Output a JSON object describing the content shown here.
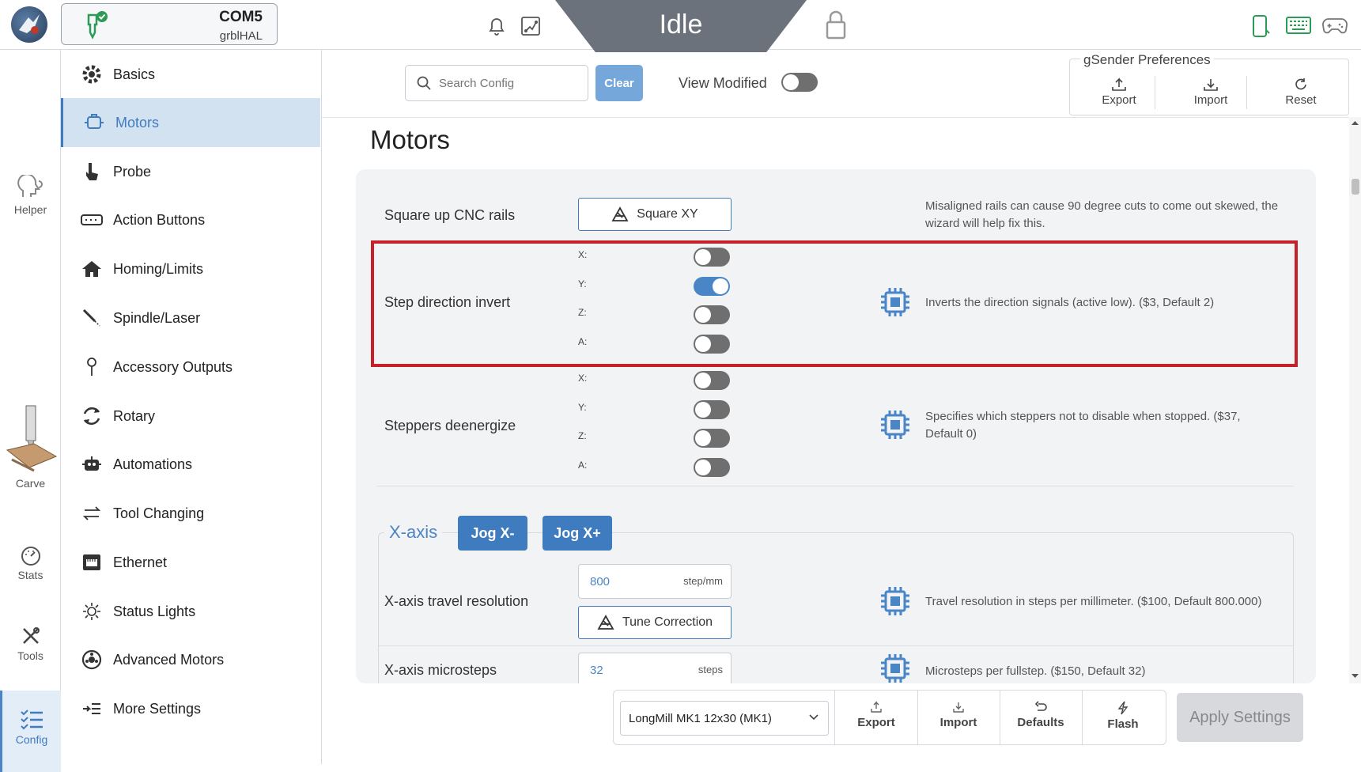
{
  "connection": {
    "port": "COM5",
    "firmware": "grblHAL"
  },
  "status": "Idle",
  "rail": {
    "helper": "Helper",
    "carve": "Carve",
    "stats": "Stats",
    "tools": "Tools",
    "config": "Config"
  },
  "menu": {
    "items": [
      {
        "label": "Basics",
        "icon": "gear-icon"
      },
      {
        "label": "Motors",
        "icon": "motor-icon",
        "active": true
      },
      {
        "label": "Probe",
        "icon": "probe-icon"
      },
      {
        "label": "Action Buttons",
        "icon": "action-buttons-icon"
      },
      {
        "label": "Homing/Limits",
        "icon": "home-icon"
      },
      {
        "label": "Spindle/Laser",
        "icon": "spindle-icon"
      },
      {
        "label": "Accessory Outputs",
        "icon": "accessory-icon"
      },
      {
        "label": "Rotary",
        "icon": "rotary-icon"
      },
      {
        "label": "Automations",
        "icon": "robot-icon"
      },
      {
        "label": "Tool Changing",
        "icon": "swap-icon"
      },
      {
        "label": "Ethernet",
        "icon": "ethernet-icon"
      },
      {
        "label": "Status Lights",
        "icon": "light-icon"
      },
      {
        "label": "Advanced Motors",
        "icon": "advanced-motor-icon"
      },
      {
        "label": "More Settings",
        "icon": "more-settings-icon"
      }
    ]
  },
  "toolbar": {
    "search_placeholder": "Search Config",
    "clear_label": "Clear",
    "view_modified_label": "View Modified",
    "view_modified_on": false
  },
  "prefs": {
    "title": "gSender Preferences",
    "export": "Export",
    "import": "Import",
    "reset": "Reset"
  },
  "page": {
    "title": "Motors",
    "square": {
      "label": "Square up CNC rails",
      "button": "Square XY",
      "desc_line1": "Misaligned rails can cause 90 degree cuts to come out skewed, the",
      "desc_line2": "wizard will help fix this."
    },
    "step_invert": {
      "label": "Step direction invert",
      "axes": [
        "X:",
        "Y:",
        "Z:",
        "A:"
      ],
      "states": [
        false,
        true,
        false,
        false
      ],
      "desc": "Inverts the direction signals (active low). ($3, Default 2)"
    },
    "deenergize": {
      "label": "Steppers deenergize",
      "axes": [
        "X:",
        "Y:",
        "Z:",
        "A:"
      ],
      "states": [
        false,
        false,
        false,
        false
      ],
      "desc_line1": "Specifies which steppers not to disable when stopped. ($37,",
      "desc_line2": "Default 0)"
    },
    "xaxis": {
      "title": "X-axis",
      "jog_minus": "Jog X-",
      "jog_plus": "Jog X+",
      "travel": {
        "label": "X-axis travel resolution",
        "value": "800",
        "unit": "step/mm",
        "button": "Tune Correction",
        "desc": "Travel resolution in steps per millimeter. ($100, Default 800.000)"
      },
      "microsteps": {
        "label": "X-axis microsteps",
        "value": "32",
        "unit": "steps",
        "desc": "Microsteps per fullstep. ($150, Default 32)"
      }
    }
  },
  "bottom": {
    "profile": "LongMill MK1 12x30 (MK1)",
    "export": "Export",
    "import": "Import",
    "defaults": "Defaults",
    "flash": "Flash",
    "apply": "Apply Settings"
  },
  "colors": {
    "accent": "#3f7bbf",
    "highlight": "#c8202a",
    "status_bg": "#6b727c"
  }
}
